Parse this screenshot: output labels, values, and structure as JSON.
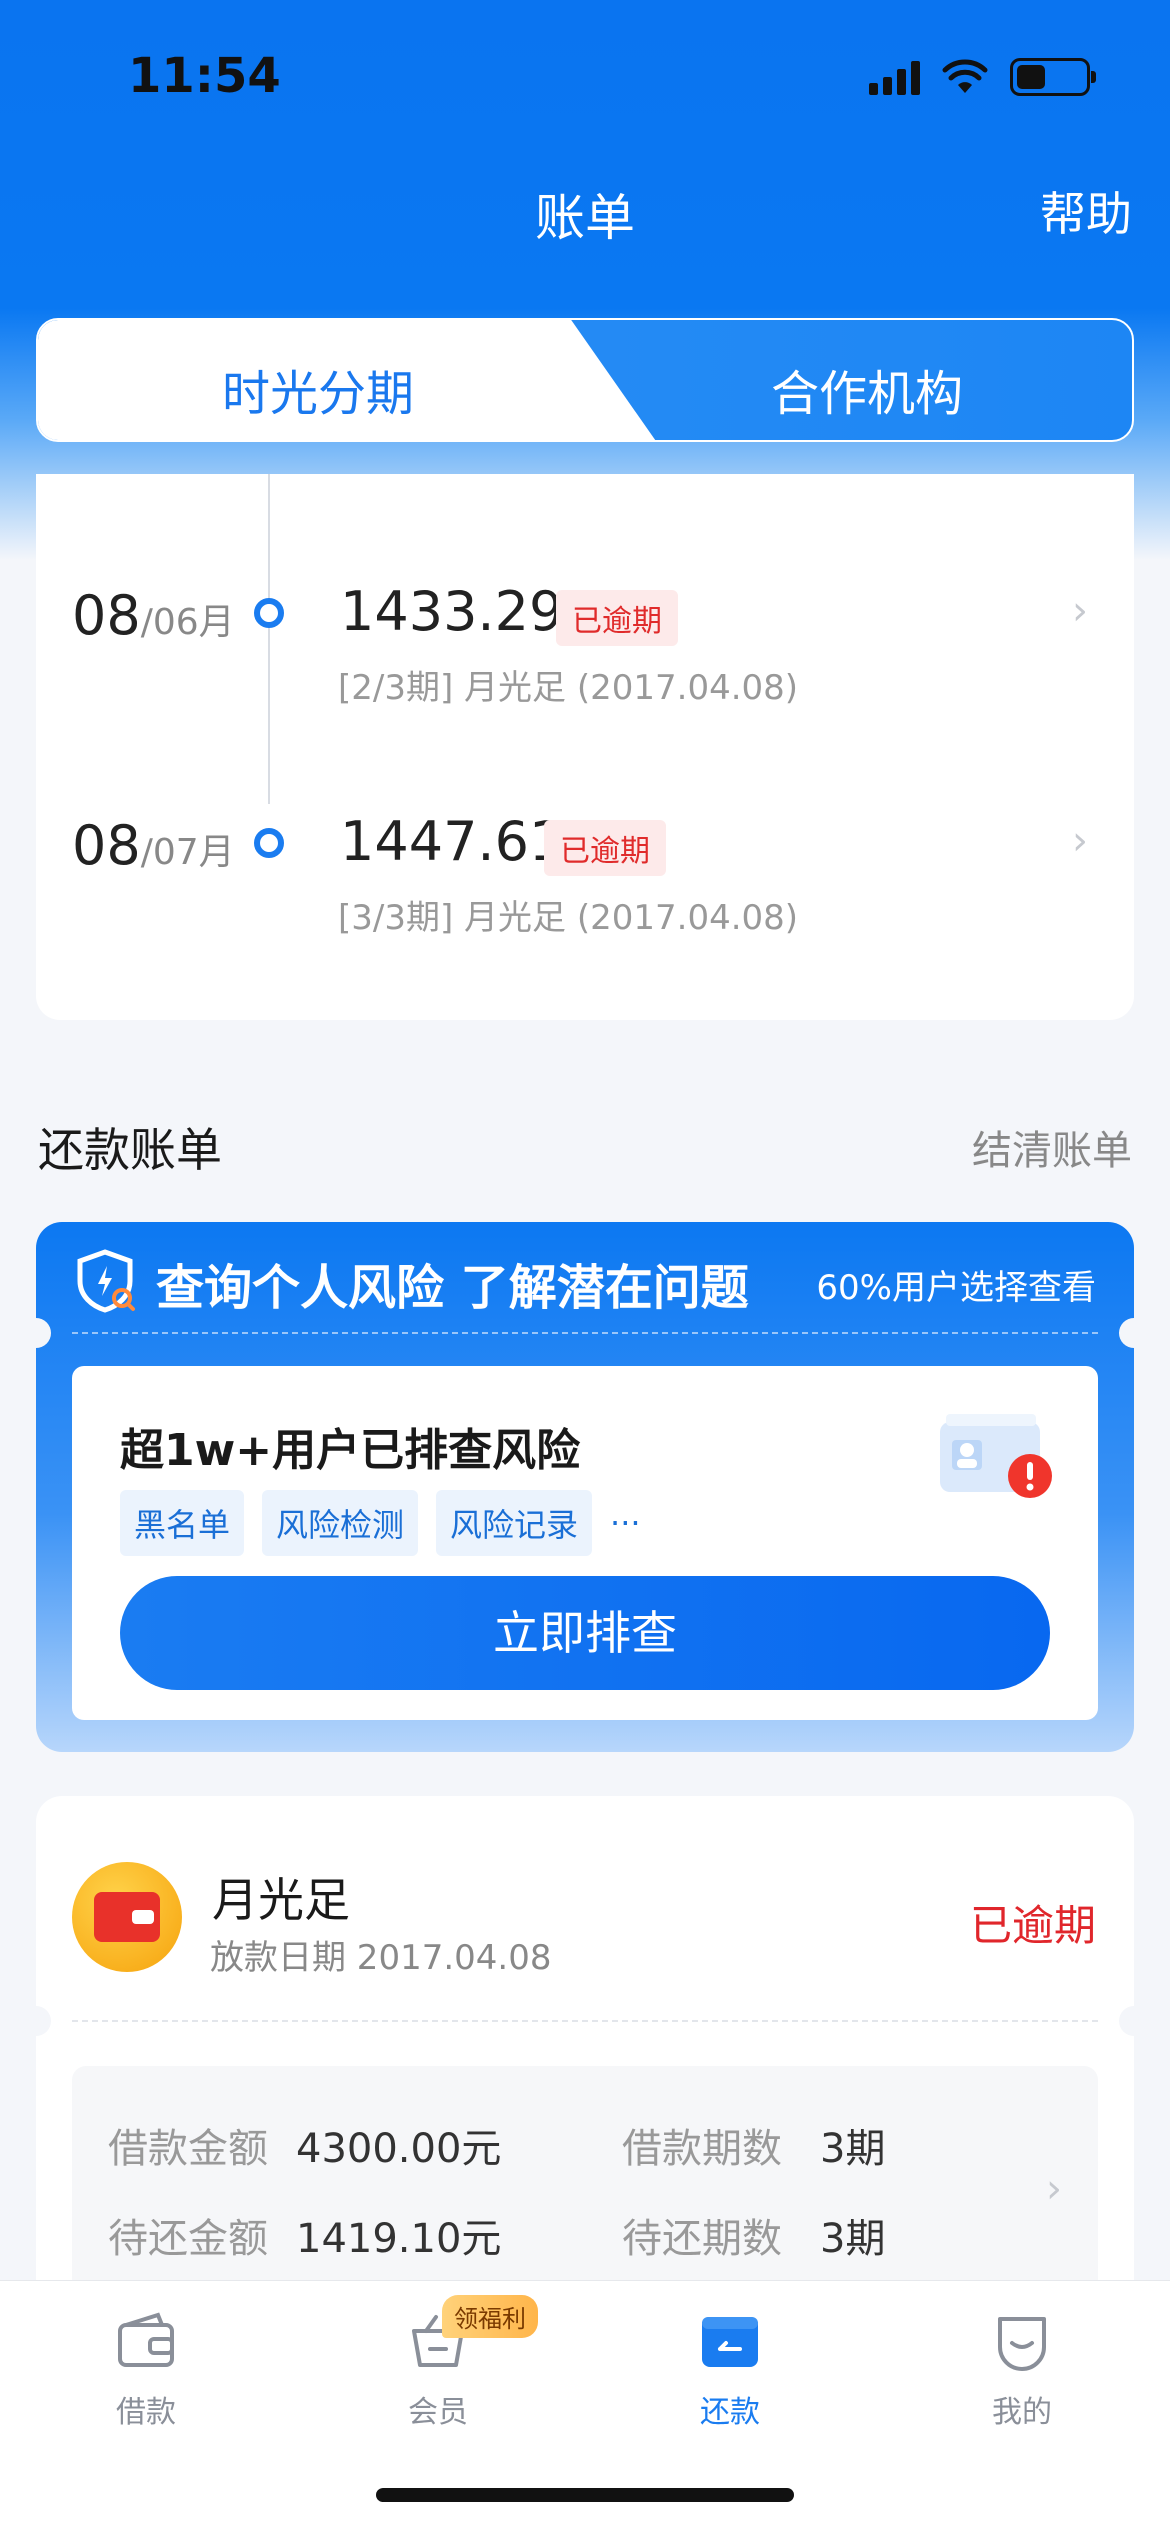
{
  "status_bar": {
    "time": "11:54"
  },
  "nav": {
    "title": "账单",
    "help": "帮助"
  },
  "segment": {
    "tab1": "时光分期",
    "tab2": "合作机构"
  },
  "timeline": {
    "rows": [
      {
        "day": "08",
        "month": "/06月",
        "amount": "1433.29",
        "badge": "已逾期",
        "sub": "[2/3期]  月光足 (2017.04.08)"
      },
      {
        "day": "08",
        "month": "/07月",
        "amount": "1447.61",
        "badge": "已逾期",
        "sub": "[3/3期]  月光足 (2017.04.08)"
      }
    ]
  },
  "section": {
    "title": "还款账单",
    "link": "结清账单"
  },
  "risk": {
    "title": "查询个人风险 了解潜在问题",
    "percent": "60%用户选择查看",
    "inner_title": "超1w+用户已排查风险",
    "tags": [
      "黑名单",
      "风险检测",
      "风险记录"
    ],
    "more": "···",
    "button": "立即排查"
  },
  "loan": {
    "name": "月光足",
    "date": "放款日期 2017.04.08",
    "status": "已逾期",
    "details": {
      "amount_label": "借款金额",
      "amount_value": "4300.00元",
      "periods_label": "借款期数",
      "periods_value": "3期",
      "due_label": "待还金额",
      "due_value": "1419.10元",
      "due_periods_label": "待还期数",
      "due_periods_value": "3期"
    }
  },
  "tabbar": {
    "items": [
      {
        "label": "借款",
        "icon": "wallet-icon"
      },
      {
        "label": "会员",
        "icon": "member-basket-icon",
        "badge": "领福利"
      },
      {
        "label": "还款",
        "icon": "repay-icon"
      },
      {
        "label": "我的",
        "icon": "smile-face-icon"
      }
    ]
  },
  "colors": {
    "primary": "#0a74f0",
    "danger": "#e0262b"
  }
}
